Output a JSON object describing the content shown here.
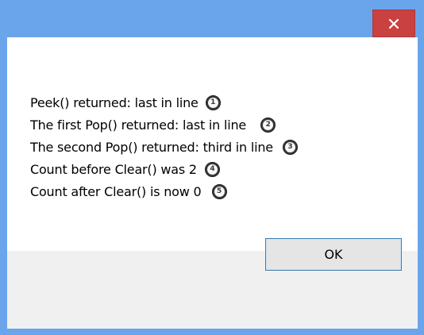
{
  "dialog": {
    "lines": [
      {
        "text": "Peek() returned: last in line",
        "badge": "1"
      },
      {
        "text": "The first Pop() returned: last in line",
        "badge": "2"
      },
      {
        "text": "The second Pop() returned: third in line",
        "badge": "3"
      },
      {
        "text": "Count before Clear() was 2",
        "badge": "4"
      },
      {
        "text": "Count after Clear() is now 0",
        "badge": "5"
      }
    ],
    "ok_label": "OK"
  },
  "colors": {
    "titlebar": "#6aa5ec",
    "close_button": "#c94141",
    "button_strip": "#f0f0f0",
    "ok_border": "#3c7fb1"
  },
  "icons": {
    "close": "close-icon"
  }
}
